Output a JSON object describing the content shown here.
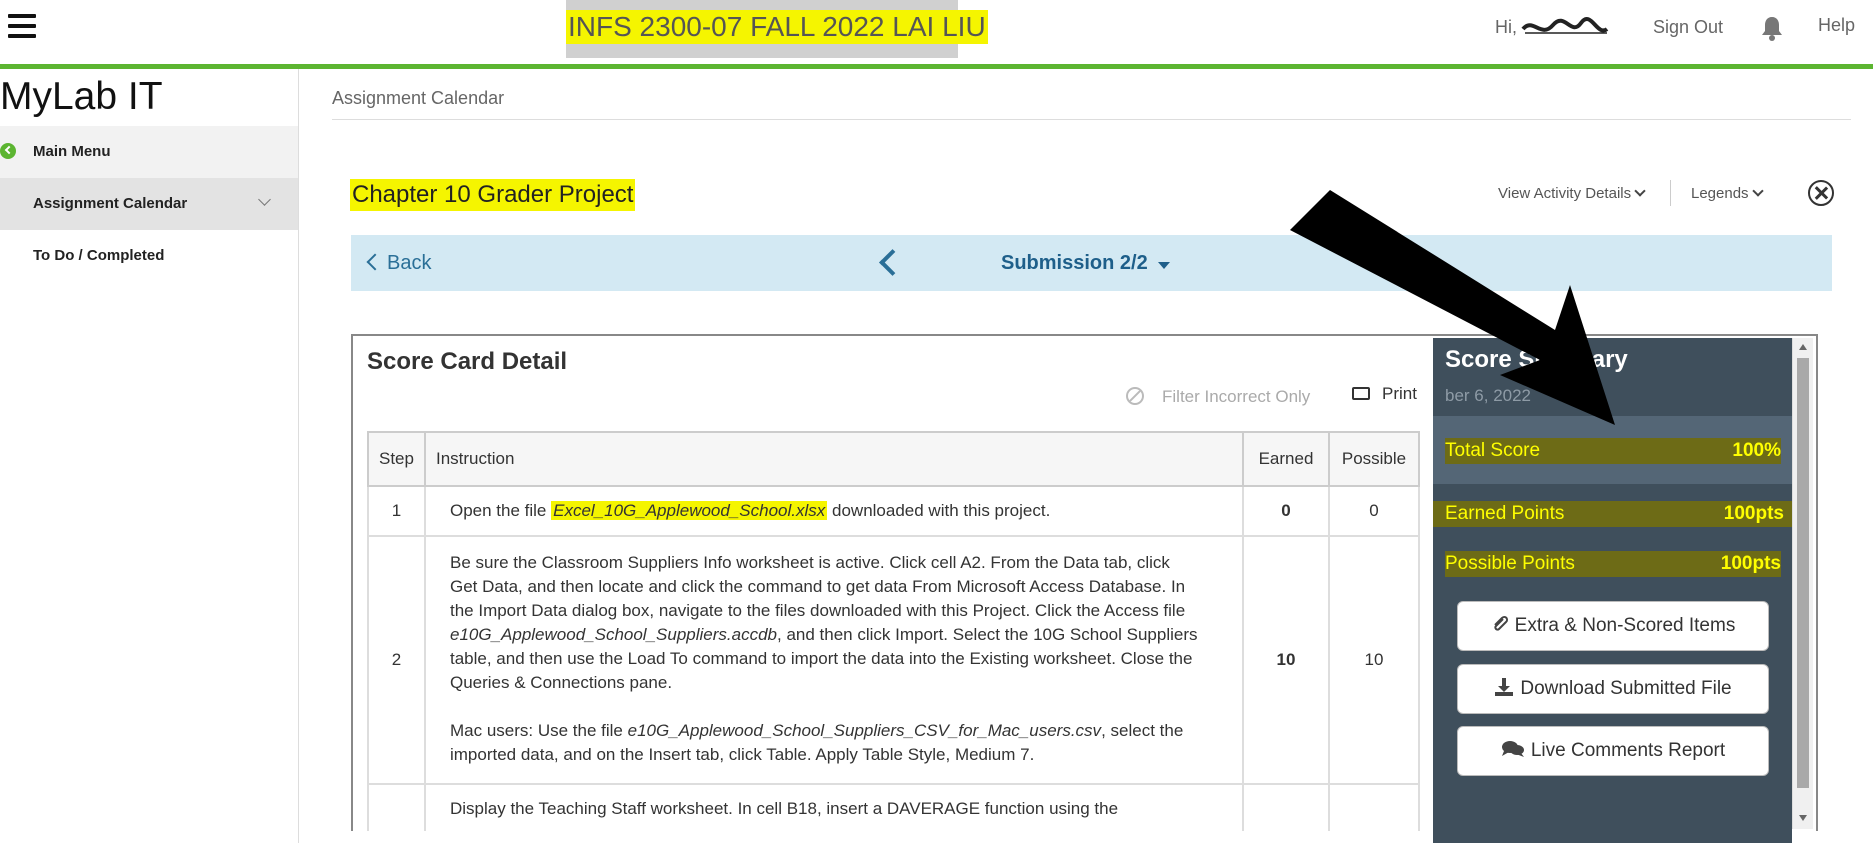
{
  "header": {
    "course_title": "INFS 2300-07 FALL 2022 LAI LIU",
    "greeting": "Hi,",
    "sign_out": "Sign Out",
    "help": "Help"
  },
  "sidebar": {
    "brand": "MyLab IT",
    "items": [
      {
        "label": "Main Menu"
      },
      {
        "label": "Assignment Calendar"
      },
      {
        "label": "To Do / Completed"
      }
    ]
  },
  "breadcrumb": "Assignment Calendar",
  "project": {
    "title": "Chapter 10 Grader Project",
    "view_activity_details": "View Activity Details",
    "legends": "Legends"
  },
  "submission_bar": {
    "back": "Back",
    "submission": "Submission 2/2"
  },
  "score_card": {
    "title": "Score Card Detail",
    "filter_label": "Filter Incorrect Only",
    "print_label": "Print",
    "columns": [
      "Step",
      "Instruction",
      "Earned",
      "Possible"
    ],
    "rows": [
      {
        "step": "1",
        "instr_pre": "Open the file ",
        "instr_file": "Excel_10G_Applewood_School.xlsx",
        "instr_post": " downloaded with this project.",
        "earned": "0",
        "possible": "0"
      },
      {
        "step": "2",
        "instr_a": "Be sure the Classroom Suppliers Info worksheet is active. Click cell A2. From the Data tab, click Get Data, and then locate and click the command to get data From Microsoft Access Database. In the Import Data dialog box, navigate to the files downloaded with this Project. Click the Access file ",
        "instr_a_file": "e10G_Applewood_School_Suppliers.accdb",
        "instr_a_post": ", and then click Import. Select the 10G School Suppliers table, and then use the Load To command to import the data into the Existing worksheet. Close the Queries & Connections pane.",
        "instr_b": "Mac users: Use the file ",
        "instr_b_file": "e10G_Applewood_School_Suppliers_CSV_for_Mac_users.csv",
        "instr_b_post": ", select the imported data, and on the Insert tab, click Table. Apply Table Style, Medium 7.",
        "earned": "10",
        "possible": "10"
      },
      {
        "step": "",
        "instr": "Display the Teaching Staff worksheet. In cell B18, insert a DAVERAGE function using the",
        "earned": "",
        "possible": ""
      }
    ]
  },
  "summary": {
    "title": "Score Summary",
    "subtitle": "ber 6, 2022",
    "total_score_label": "Total Score",
    "total_score_value": "100%",
    "earned_points_label": "Earned Points",
    "earned_points_value": "100pts",
    "possible_points_label": "Possible Points",
    "possible_points_value": "100pts",
    "actions": [
      {
        "label": "Extra & Non-Scored Items"
      },
      {
        "label": "Download Submitted File"
      },
      {
        "label": "Live Comments Report"
      }
    ]
  },
  "colors": {
    "accent_green": "#5cb531",
    "highlight_yellow": "#f5f500",
    "link_blue": "#2a6f97",
    "summary_bg": "#3f4f5c"
  }
}
